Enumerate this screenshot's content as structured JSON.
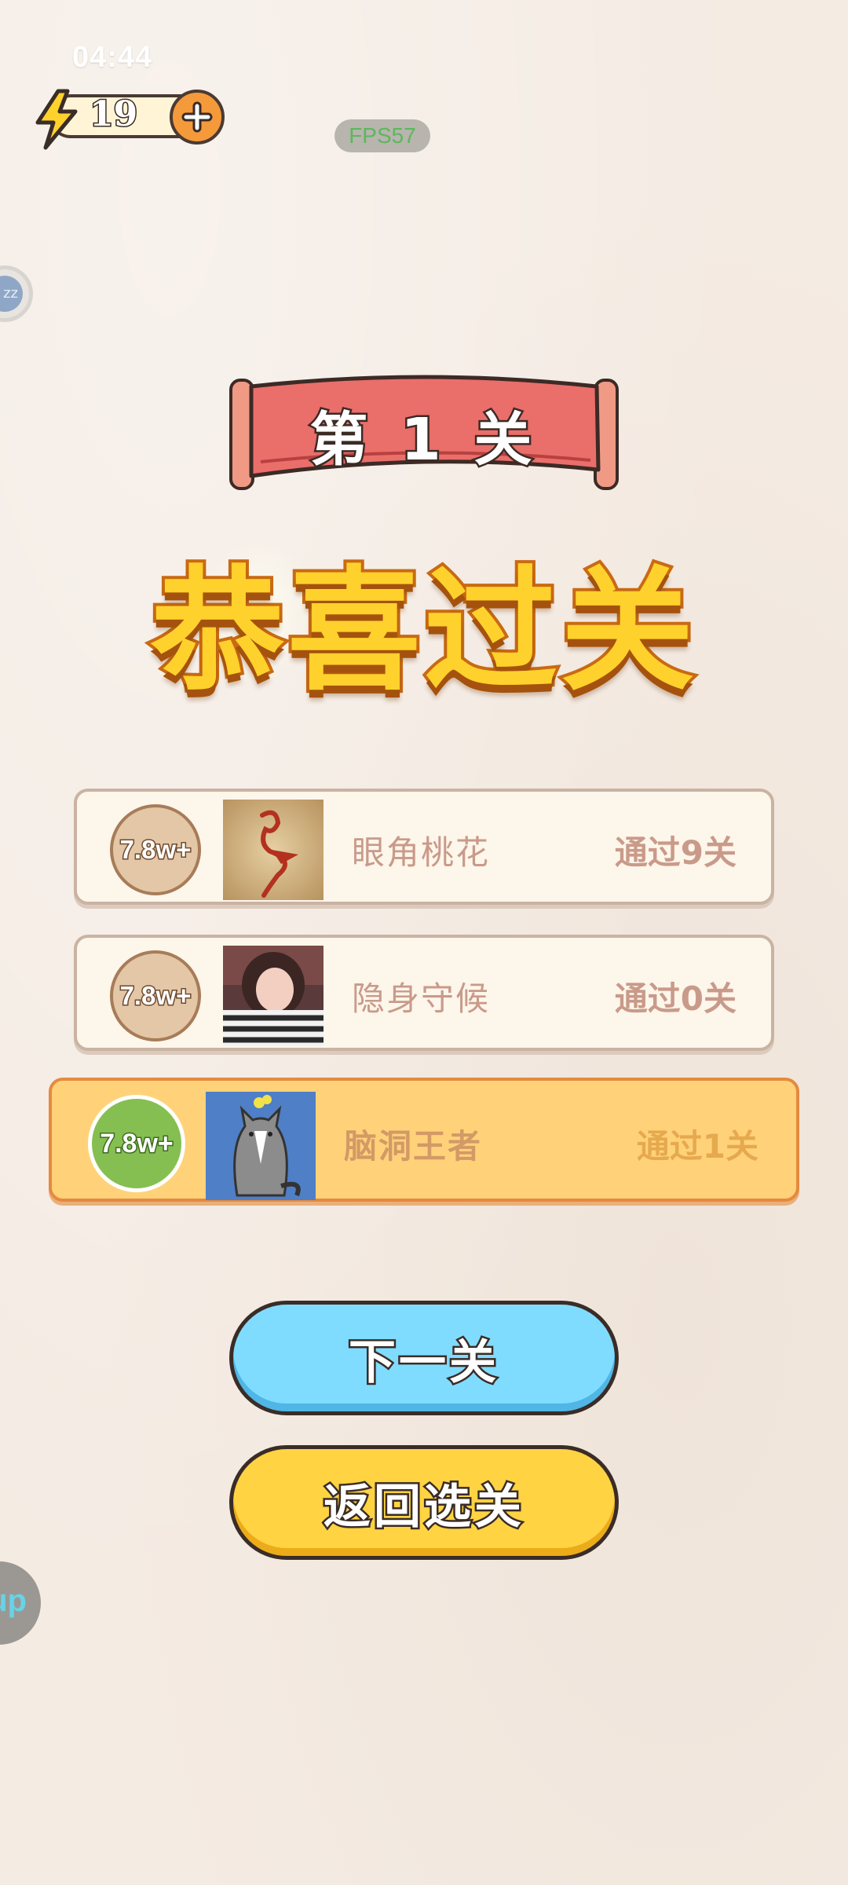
{
  "status": {
    "time": "04:44"
  },
  "energy": {
    "value": "19"
  },
  "fps": "FPS57",
  "float_buttons": {
    "top_label": "zz",
    "bottom_label": "up"
  },
  "level_banner": "第 1 关",
  "congrats": "恭喜过关",
  "ranking": [
    {
      "badge": "7.8w+",
      "name": "眼角桃花",
      "progress": "通过9关",
      "is_me": false
    },
    {
      "badge": "7.8w+",
      "name": "隐身守候",
      "progress": "通过0关",
      "is_me": false
    },
    {
      "badge": "7.8w+",
      "name": "脑洞王者",
      "progress": "通过1关",
      "is_me": true
    }
  ],
  "buttons": {
    "next": "下一关",
    "back": "返回选关"
  },
  "colors": {
    "background": "#f4ebe3",
    "banner": "#ea6e6a",
    "congrats": "#ffd12c",
    "highlight_row": "#ffd27a",
    "next_button": "#7fdcff",
    "back_button": "#ffd342"
  },
  "icons": {
    "energy": "lightning-bolt-icon",
    "add": "plus-icon"
  }
}
